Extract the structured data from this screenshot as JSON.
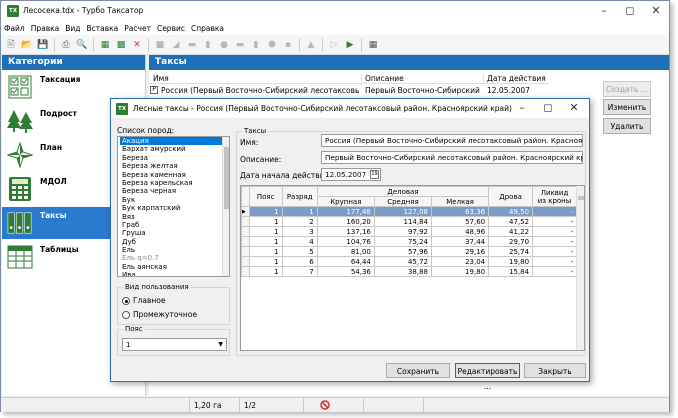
{
  "window": {
    "title": "Лесосека.tdx - Турбо Таксатор",
    "app_icon": "TX"
  },
  "menu": [
    "Файл",
    "Правка",
    "Вид",
    "Вставка",
    "Расчет",
    "Сервис",
    "Справка"
  ],
  "sidebar": {
    "header": "Категории",
    "items": [
      {
        "label": "Таксация",
        "icon": "grid-check-icon"
      },
      {
        "label": "Подрост",
        "icon": "trees-icon"
      },
      {
        "label": "План",
        "icon": "compass-icon"
      },
      {
        "label": "МДОЛ",
        "icon": "calculator-icon"
      },
      {
        "label": "Таксы",
        "icon": "binders-icon",
        "selected": true
      },
      {
        "label": "Таблицы",
        "icon": "table-icon"
      }
    ]
  },
  "main": {
    "header": "Таксы",
    "columns": [
      "Имя",
      "Описание",
      "Дата действия"
    ],
    "row": {
      "marker": "P",
      "name": "Россия (Первый Восточно-Сибирский лесотаксовый рай...",
      "desc": "Первый Восточно-Сибирский ле...",
      "date": "12.05.2007"
    },
    "buttons": {
      "create": "Создать ...",
      "edit": "Изменить ...",
      "delete": "Удалить"
    }
  },
  "status": {
    "area": "1,20 га",
    "page": "1/2"
  },
  "dialog": {
    "title": "Лесные таксы - Россия (Первый Восточно-Сибирский лесотаксовый район. Красноярский край)",
    "species_label": "Список пород:",
    "species": [
      "Акация",
      "Бархат амурский",
      "Береза",
      "Береза желтая",
      "Береза каменная",
      "Береза карельская",
      "Береза черная",
      "Бук",
      "Бук карпатский",
      "Вяз",
      "Граб",
      "Груша",
      "Дуб",
      "Ель",
      "Ель q=0.7",
      "Ель аянская",
      "Ива"
    ],
    "species_selected": 0,
    "usage_group": "Вид пользования",
    "usage_options": [
      "Главное",
      "Промежуточное"
    ],
    "usage_selected": 0,
    "belt_group": "Пояс",
    "belt_value": "1",
    "taxes_group": "Таксы",
    "name_label": "Имя:",
    "name_value": "Россия (Первый Восточно-Сибирский лесотаксовый район. Красноярский край)",
    "desc_label": "Описание:",
    "desc_value": "Первый Восточно-Сибирский лесотаксовый район. Красноярский край.",
    "date_label": "Дата начала действия:",
    "date_value": "12.05.2007",
    "grid_headers": {
      "belt": "Пояс",
      "rank": "Разряд",
      "business": "Деловая",
      "large": "Крупная",
      "medium": "Средняя",
      "small": "Мелкая",
      "fuel": "Дрова",
      "liquid": "Ликвид из кроны"
    },
    "grid_rows": [
      [
        "1",
        "1",
        "177,48",
        "127,08",
        "63,36",
        "49,50",
        "-"
      ],
      [
        "1",
        "2",
        "160,20",
        "114,84",
        "57,60",
        "47,52",
        "-"
      ],
      [
        "1",
        "3",
        "137,16",
        "97,92",
        "48,96",
        "41,22",
        "-"
      ],
      [
        "1",
        "4",
        "104,76",
        "75,24",
        "37,44",
        "29,70",
        "-"
      ],
      [
        "1",
        "5",
        "81,00",
        "57,96",
        "29,16",
        "25,74",
        "-"
      ],
      [
        "1",
        "6",
        "64,44",
        "45,72",
        "23,04",
        "19,80",
        "-"
      ],
      [
        "1",
        "7",
        "54,36",
        "38,88",
        "19,80",
        "15,84",
        "-"
      ]
    ],
    "buttons": {
      "save": "Сохранить",
      "edit": "Редактировать ...",
      "close": "Закрыть"
    }
  },
  "colors": {
    "accent": "#1e6fb8",
    "selected": "#2a7bd0",
    "brand": "#2e7d32"
  }
}
